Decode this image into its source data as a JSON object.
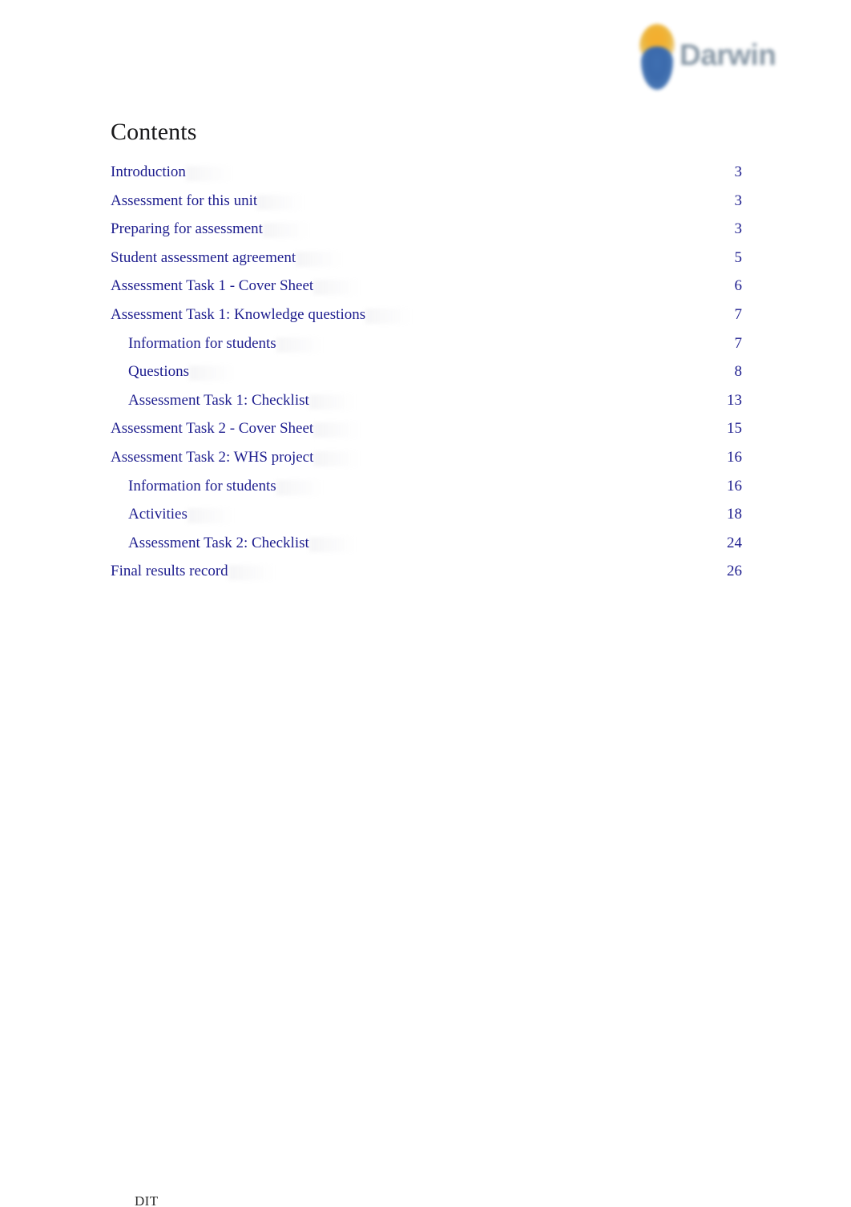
{
  "document": {
    "heading": "Contents"
  },
  "logo": {
    "wordmark": "Darwin",
    "tagline": "",
    "mark_flame_color": "#f0a91f",
    "mark_shield_color": "#2b5ea6",
    "wordmark_color": "#5b7185"
  },
  "toc": {
    "link_color": "#1d1d8e",
    "entries": [
      {
        "label": "Introduction",
        "page": "3",
        "level": 1
      },
      {
        "label": "Assessment for this unit",
        "page": "3",
        "level": 1
      },
      {
        "label": "Preparing for assessment",
        "page": "3",
        "level": 1
      },
      {
        "label": "Student assessment agreement",
        "page": "5",
        "level": 1
      },
      {
        "label": "Assessment Task 1 - Cover Sheet",
        "page": "6",
        "level": 1
      },
      {
        "label": "Assessment Task 1: Knowledge questions",
        "page": "7",
        "level": 1
      },
      {
        "label": "Information for students",
        "page": "7",
        "level": 2
      },
      {
        "label": "Questions",
        "page": "8",
        "level": 2
      },
      {
        "label": "Assessment Task 1: Checklist",
        "page": "13",
        "level": 2
      },
      {
        "label": "Assessment Task 2 - Cover Sheet",
        "page": "15",
        "level": 1
      },
      {
        "label": "Assessment Task 2: WHS project",
        "page": "16",
        "level": 1
      },
      {
        "label": "Information for students",
        "page": "16",
        "level": 2
      },
      {
        "label": "Activities",
        "page": "18",
        "level": 2
      },
      {
        "label": "Assessment Task 2: Checklist",
        "page": "24",
        "level": 2
      },
      {
        "label": "Final results record",
        "page": "26",
        "level": 1
      }
    ]
  },
  "footer": {
    "text": "DIT"
  }
}
